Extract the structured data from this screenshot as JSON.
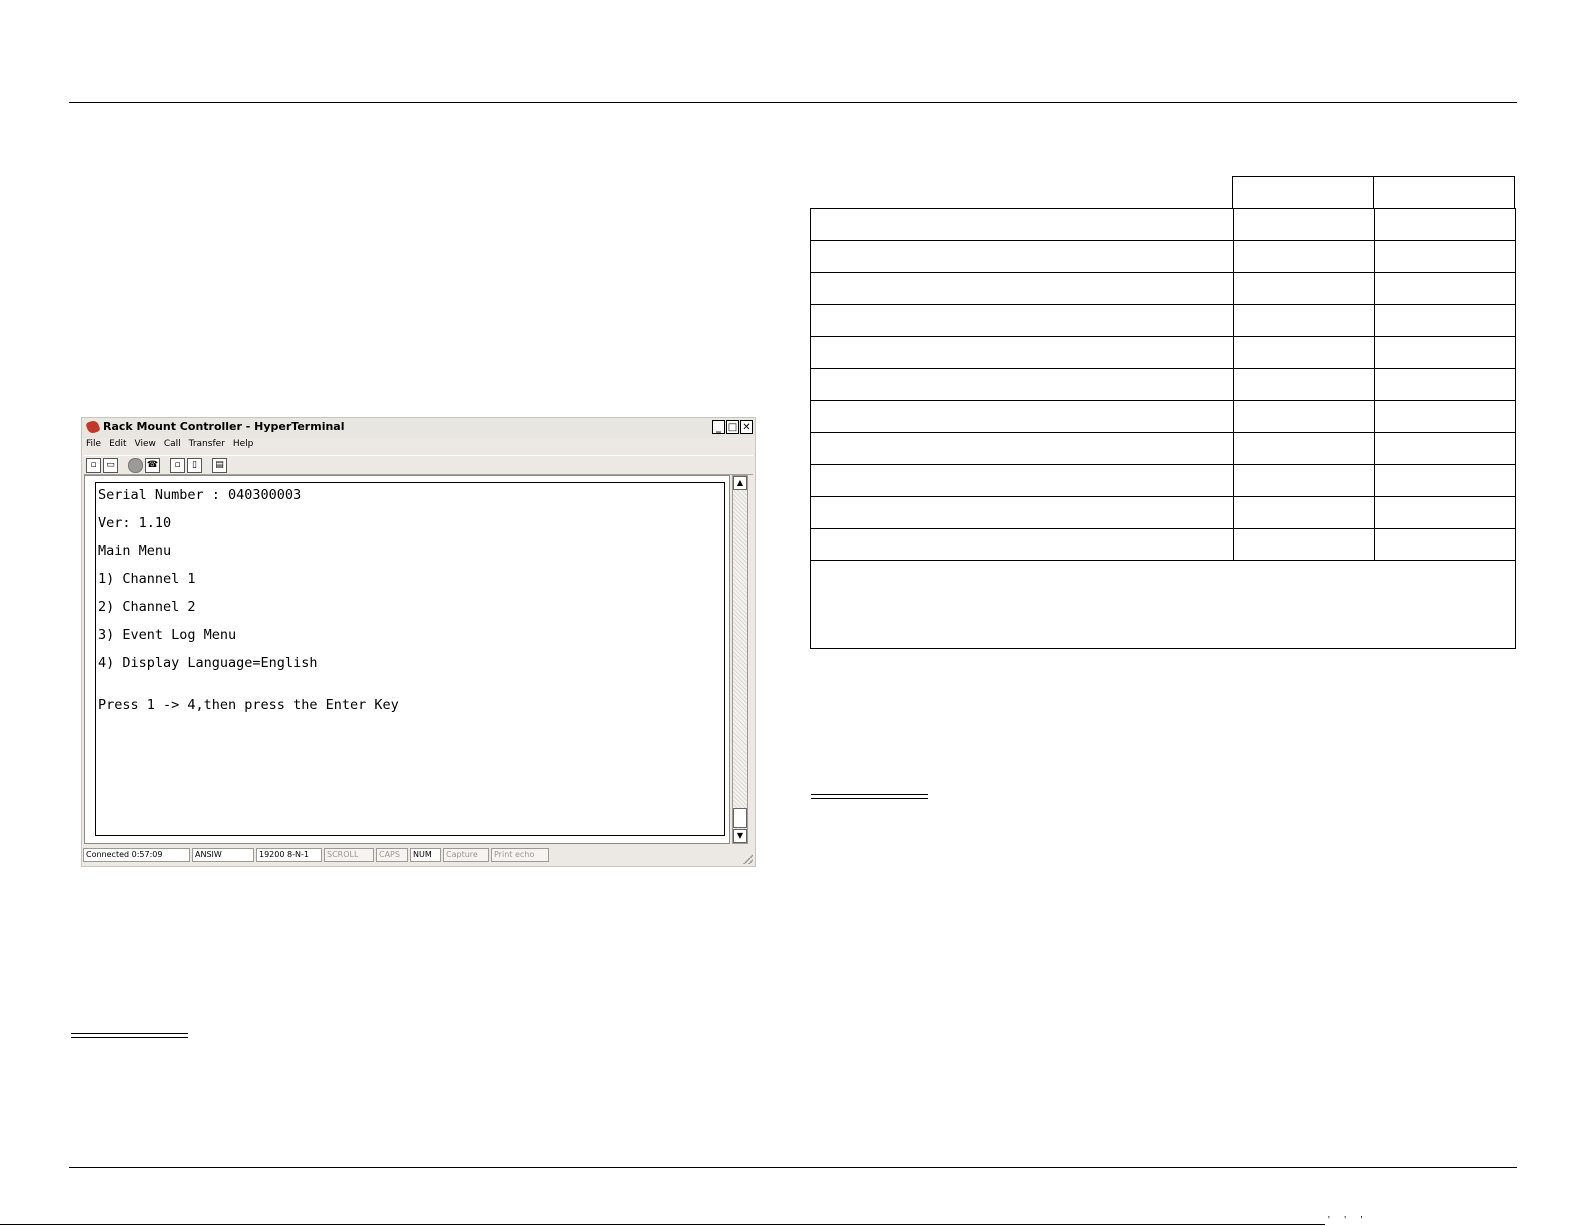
{
  "window": {
    "title": "Rack Mount Controller - HyperTerminal",
    "minimize_glyph": "_",
    "maximize_glyph": "□",
    "close_glyph": "✕",
    "menu": [
      "File",
      "Edit",
      "View",
      "Call",
      "Transfer",
      "Help"
    ],
    "toolbar_icons": [
      "new-icon",
      "open-icon",
      "disconnect-icon",
      "connect-icon",
      "send-icon",
      "receive-icon",
      "properties-icon"
    ],
    "terminal_lines": [
      "Serial Number : 040300003",
      "Ver: 1.10",
      "Main Menu",
      "1) Channel 1",
      "2) Channel 2",
      "3) Event Log Menu",
      "4) Display Language=English",
      "Press 1 -> 4,then press the Enter Key"
    ],
    "scroll_up_glyph": "▲",
    "scroll_down_glyph": "▼",
    "status": {
      "connected": "Connected 0:57:09",
      "emulation": "ANSIW",
      "port": "19200 8-N-1",
      "scroll": "SCROLL",
      "caps": "CAPS",
      "num": "NUM",
      "capture": "Capture",
      "print_echo": "Print echo"
    }
  },
  "table": {
    "header_cells": [
      "",
      ""
    ],
    "rows": [
      [
        "",
        "",
        ""
      ],
      [
        "",
        "",
        ""
      ],
      [
        "",
        "",
        ""
      ],
      [
        "",
        "",
        ""
      ],
      [
        "",
        "",
        ""
      ],
      [
        "",
        "",
        ""
      ],
      [
        "",
        "",
        ""
      ],
      [
        "",
        "",
        ""
      ],
      [
        "",
        "",
        ""
      ],
      [
        "",
        "",
        ""
      ],
      [
        "",
        "",
        ""
      ]
    ],
    "note": ""
  }
}
